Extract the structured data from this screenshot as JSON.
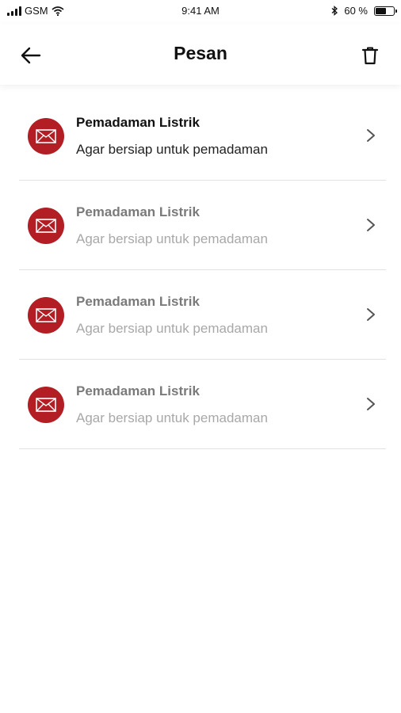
{
  "status_bar": {
    "carrier": "GSM",
    "time": "9:41 AM",
    "battery_percent": "60 %",
    "battery_level": 0.6
  },
  "header": {
    "title": "Pesan",
    "back_icon": "arrow-left-icon",
    "action_icon": "trash-icon"
  },
  "accent_color": "#b21e24",
  "messages": [
    {
      "title": "Pemadaman Listrik",
      "body": "Agar bersiap untuk pemadaman",
      "read": false
    },
    {
      "title": "Pemadaman Listrik",
      "body": "Agar bersiap untuk pemadaman",
      "read": true
    },
    {
      "title": "Pemadaman Listrik",
      "body": "Agar bersiap untuk pemadaman",
      "read": true
    },
    {
      "title": "Pemadaman Listrik",
      "body": "Agar bersiap untuk pemadaman",
      "read": true
    }
  ]
}
